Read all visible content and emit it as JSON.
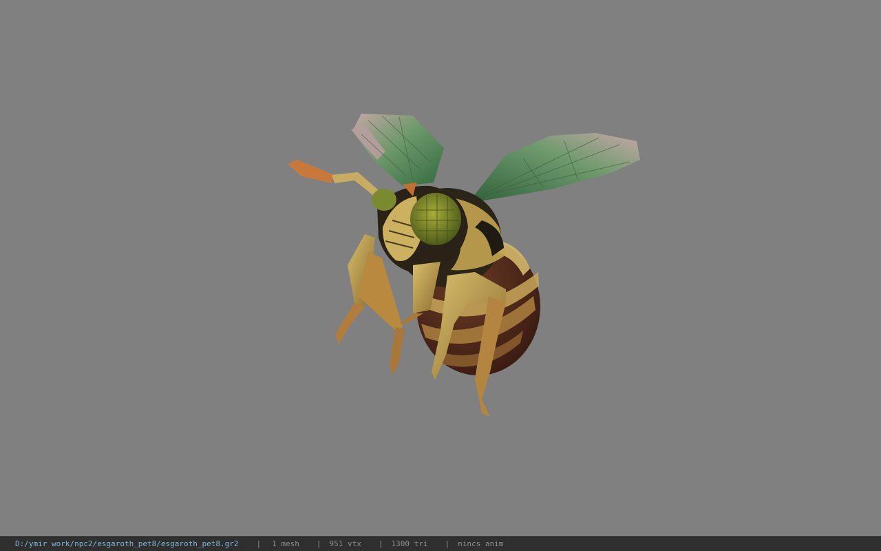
{
  "status_bar": {
    "file_path": "D:/ymir work/npc2/esgaroth_pet8/esgaroth_pet8.gr2",
    "separator": "|",
    "mesh_count": "1 mesh",
    "vertex_count": "951 vtx",
    "triangle_count": "1300 tri",
    "animation_status": "nincs anim"
  },
  "colors": {
    "viewport_background": "#808080",
    "status_bar_background": "#2f2f2f",
    "path_text": "#7fb6d6",
    "info_text": "#8e8e8e"
  }
}
